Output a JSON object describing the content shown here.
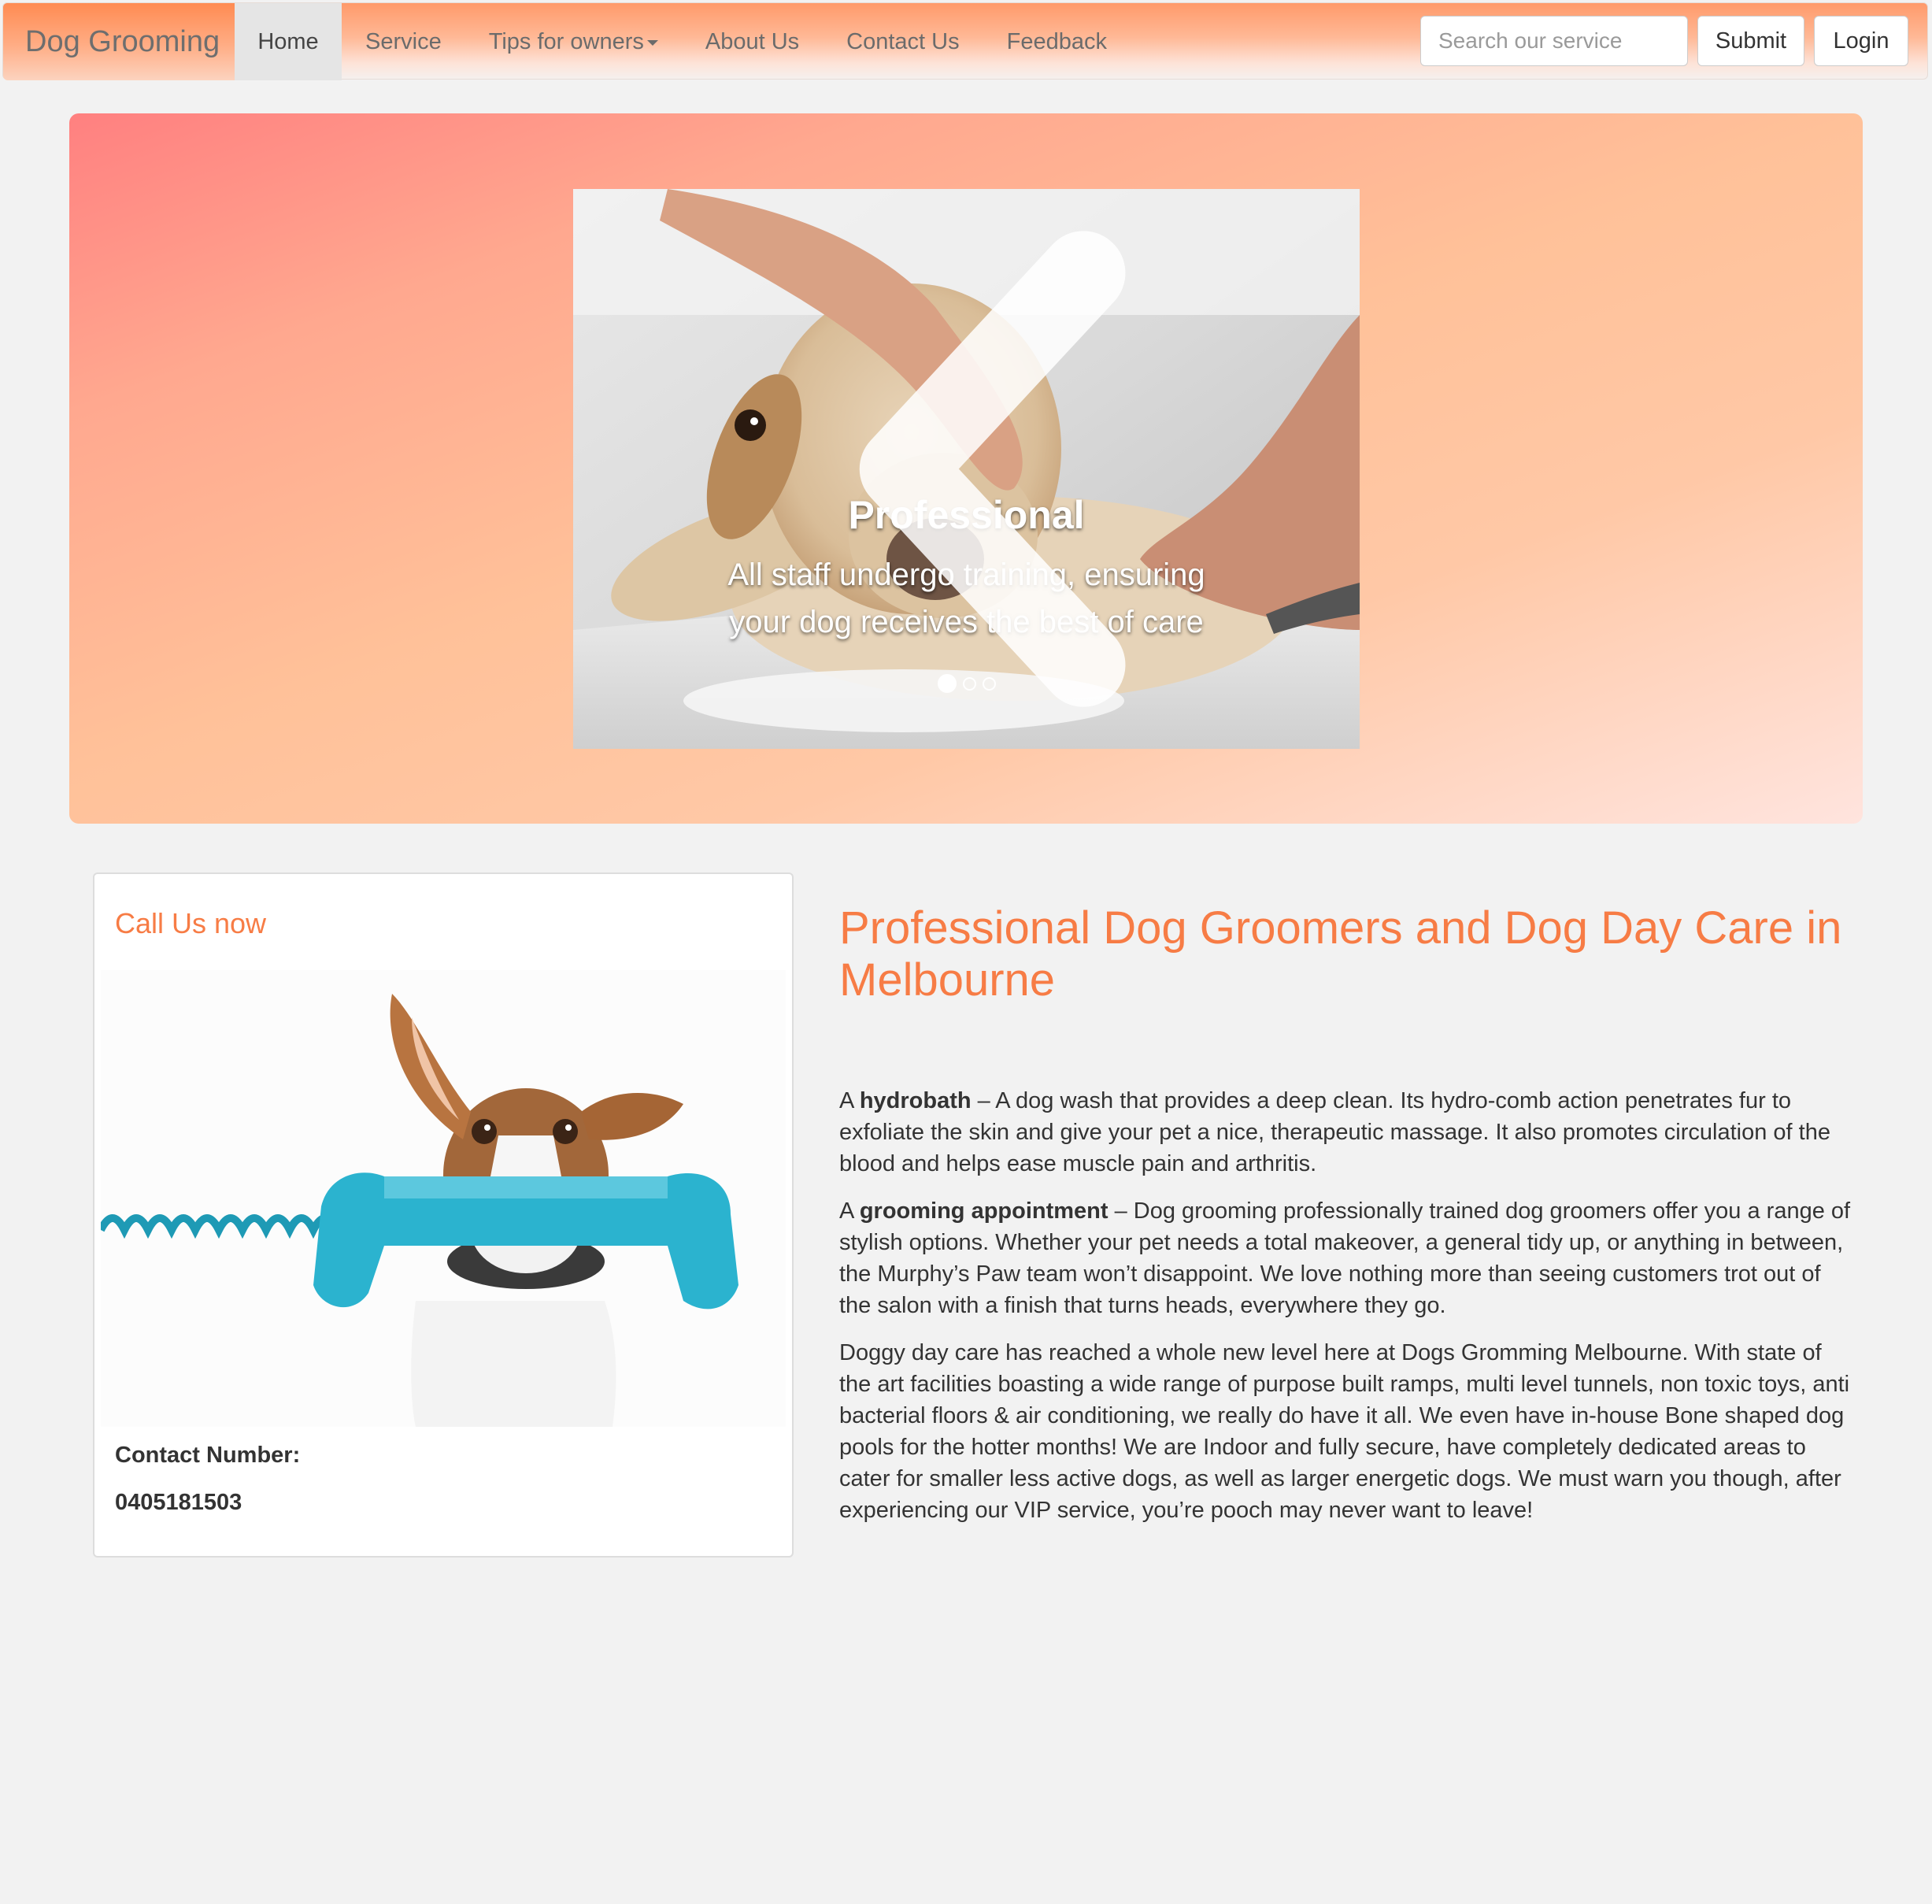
{
  "navbar": {
    "brand": "Dog Grooming",
    "items": [
      {
        "label": "Home",
        "active": true
      },
      {
        "label": "Service"
      },
      {
        "label": "Tips for owners",
        "dropdown": true
      },
      {
        "label": "About Us"
      },
      {
        "label": "Contact Us"
      },
      {
        "label": "Feedback"
      }
    ],
    "search_placeholder": "Search our service",
    "submit_label": "Submit",
    "login_label": "Login"
  },
  "carousel": {
    "slide_title": "Professional",
    "slide_text": "All staff undergo training, ensuring your dog receives the best of care",
    "slide_count": 3,
    "active_slide": 1
  },
  "call_panel": {
    "title": "Call Us now",
    "contact_label": "Contact Number:",
    "contact_number": "0405181503"
  },
  "article": {
    "heading": "Professional Dog Groomers and Dog Day Care in Melbourne",
    "p1_prefix": "A ",
    "p1_bold": "hydrobath",
    "p1_rest": " – A dog wash that provides a deep clean. Its hydro-comb action penetrates fur to exfoliate the skin and give your pet a nice, therapeutic massage. It also promotes circulation of the blood and helps ease muscle pain and arthritis.",
    "p2_prefix": "A ",
    "p2_bold": "grooming appointment",
    "p2_rest": " – Dog grooming professionally trained dog groomers offer you a range of stylish options. Whether your pet needs a total makeover, a general tidy up, or anything in between, the Murphy’s Paw team won’t disappoint. We love nothing more than seeing customers trot out of the salon with a finish that turns heads, everywhere they go.",
    "p3": "Doggy day care has reached a whole new level here at Dogs Gromming Melbourne. With state of the art facilities boasting a wide range of purpose built ramps, multi level tunnels, non toxic toys, anti bacterial floors & air conditioning, we really do have it all. We even have in-house Bone shaped dog pools for the hotter months! We are Indoor and fully secure, have completely dedicated areas to cater for smaller less active dogs, as well as larger energetic dogs. We must warn you though, after experiencing our VIP service, you’re pooch may never want to leave!"
  },
  "colors": {
    "accent": "#f77c45",
    "nav_top": "#ff9a6a",
    "jumbotron_start": "#ff8080",
    "jumbotron_end": "#ffe4de",
    "phone": "#2bb3cf"
  }
}
